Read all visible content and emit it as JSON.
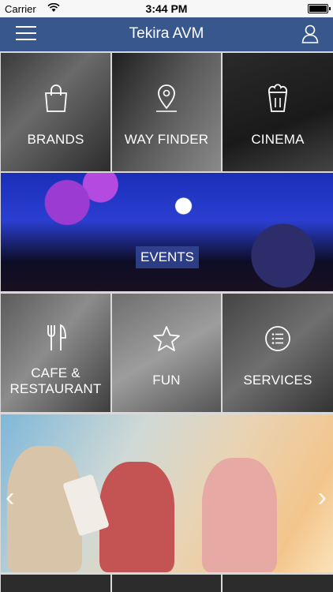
{
  "status_bar": {
    "carrier": "Carrier",
    "time": "3:44 PM"
  },
  "nav": {
    "title": "Tekira AVM"
  },
  "tiles": {
    "brands": "BRANDS",
    "way_finder": "WAY FINDER",
    "cinema": "CINEMA",
    "events": "EVENTS",
    "cafe_line1": "CAFE &",
    "cafe_line2": "RESTAURANT",
    "fun": "FUN",
    "services": "SERVICES"
  },
  "banner": {
    "prev_icon": "chevron-left-icon",
    "next_icon": "chevron-right-icon"
  },
  "colors": {
    "nav_bar": "#38588d",
    "events_label_bg": "#324696"
  }
}
